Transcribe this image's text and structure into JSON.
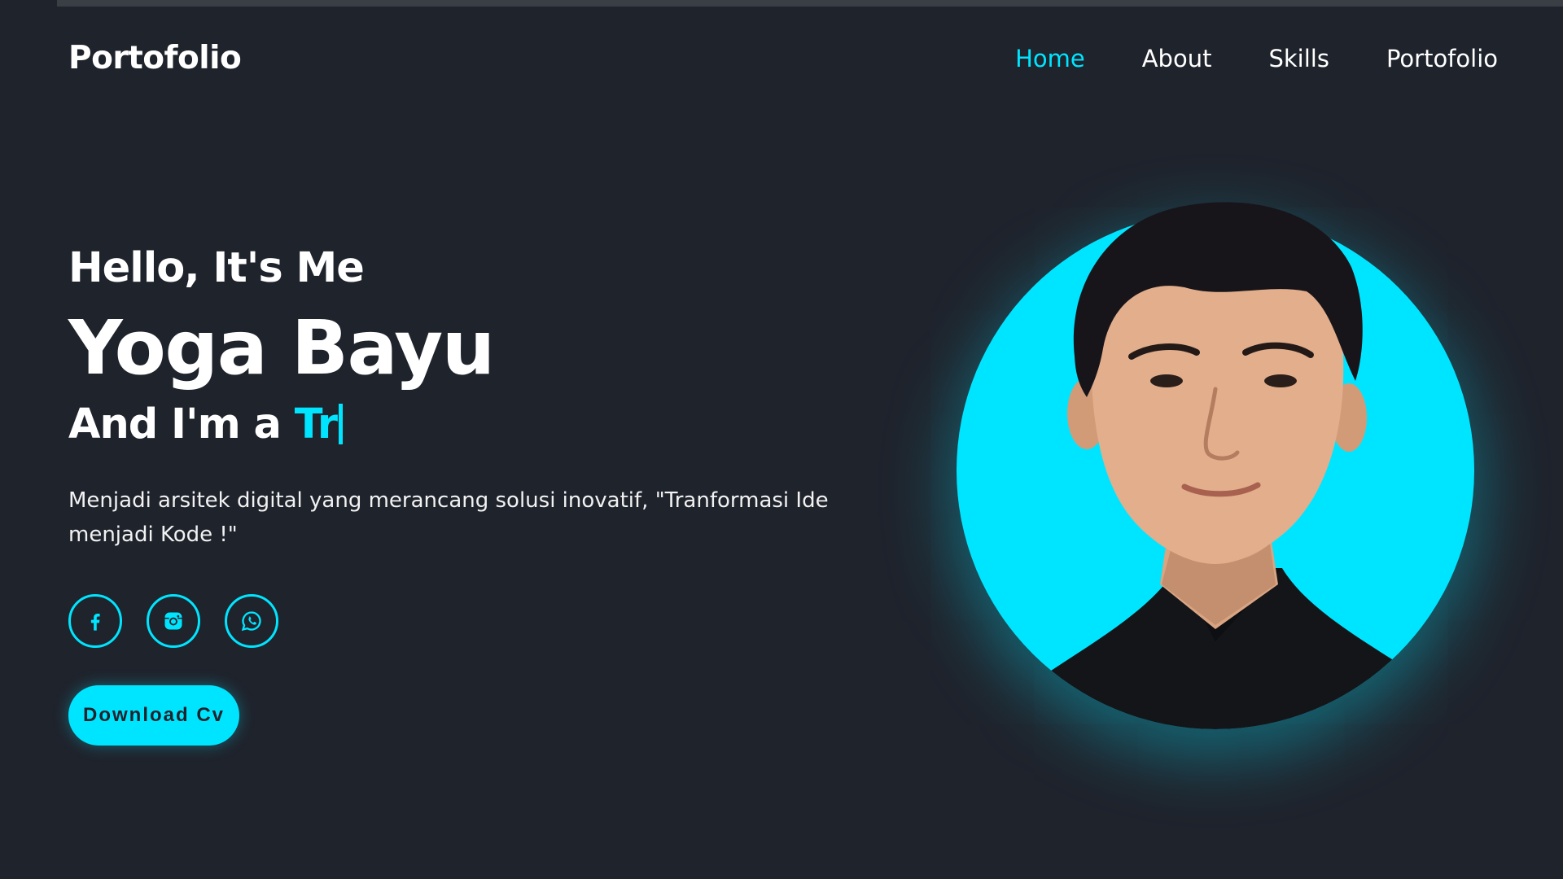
{
  "header": {
    "logo": "Portofolio",
    "nav": [
      {
        "label": "Home",
        "active": true
      },
      {
        "label": "About",
        "active": false
      },
      {
        "label": "Skills",
        "active": false
      },
      {
        "label": "Portofolio",
        "active": false
      }
    ]
  },
  "hero": {
    "greeting": "Hello, It's Me",
    "name": "Yoga Bayu",
    "role_prefix": "And I'm a",
    "role_typed": "Tr",
    "description": "Menjadi arsitek digital yang merancang solusi inovatif, \"Tranformasi Ide menjadi Kode !\"",
    "socials": [
      {
        "icon": "facebook-icon"
      },
      {
        "icon": "instagram-icon"
      },
      {
        "icon": "whatsapp-icon"
      }
    ],
    "cta_label": "Download Cv"
  },
  "colors": {
    "background": "#1f232c",
    "accent": "#00e5ff",
    "text": "#ffffff"
  }
}
